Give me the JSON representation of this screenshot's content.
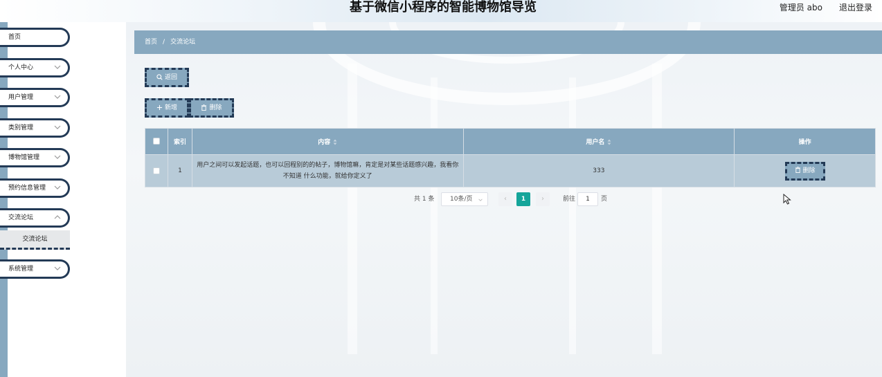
{
  "header": {
    "title": "基于微信小程序的智能博物馆导览",
    "user_label": "管理员 abo",
    "logout_label": "退出登录"
  },
  "sidebar": {
    "items": [
      {
        "label": "首页",
        "has_chevron": false
      },
      {
        "label": "个人中心",
        "has_chevron": true
      },
      {
        "label": "用户管理",
        "has_chevron": true
      },
      {
        "label": "类别管理",
        "has_chevron": true
      },
      {
        "label": "博物馆管理",
        "has_chevron": true
      },
      {
        "label": "预约信息管理",
        "has_chevron": true
      },
      {
        "label": "交流论坛",
        "has_chevron": true
      },
      {
        "label": "系统管理",
        "has_chevron": true
      }
    ],
    "submenu_label": "交流论坛"
  },
  "breadcrumb": {
    "home": "首页",
    "separator": "/",
    "current": "交流论坛"
  },
  "toolbar": {
    "back_label": "返回",
    "add_label": "新增",
    "delete_label": "删除"
  },
  "table": {
    "headers": {
      "index": "索引",
      "content": "内容",
      "username": "用户名",
      "actions": "操作"
    },
    "rows": [
      {
        "index": "1",
        "content": "用户之间可以发起话题，也可以回程别的的帖子，博物馆嘛，肯定是对某些话题感兴趣，我看你不知道 什么功能，就给你定义了",
        "username": "333",
        "delete_label": "删除"
      }
    ]
  },
  "pagination": {
    "total_label": "共 1 条",
    "page_size": "10条/页",
    "current_page": "1",
    "goto_label": "前往",
    "goto_value": "1",
    "page_suffix": "页"
  },
  "colors": {
    "accent": "#87a8bf",
    "dark_border": "#233a56",
    "active_page": "#15a59a"
  }
}
